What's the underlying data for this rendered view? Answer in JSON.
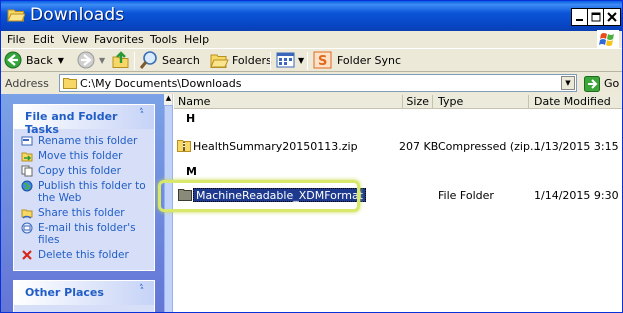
{
  "window": {
    "title": "Downloads",
    "icon": "folder-open-icon"
  },
  "menu": {
    "items": [
      "File",
      "Edit",
      "View",
      "Favorites",
      "Tools",
      "Help"
    ]
  },
  "toolbar": {
    "back_label": "Back",
    "search_label": "Search",
    "folders_label": "Folders",
    "folder_sync_label": "Folder Sync"
  },
  "address": {
    "label": "Address",
    "path": "C:\\My Documents\\Downloads",
    "go_label": "Go"
  },
  "tasks_pane": {
    "title": "File and Folder Tasks",
    "collapse_glyph": "«",
    "items": [
      {
        "label": "Rename this folder",
        "icon": "rename-icon"
      },
      {
        "label": "Move this folder",
        "icon": "move-icon"
      },
      {
        "label": "Copy this folder",
        "icon": "copy-icon"
      },
      {
        "label": "Publish this folder to the Web",
        "icon": "publish-web-icon"
      },
      {
        "label": "Share this folder",
        "icon": "share-icon"
      },
      {
        "label": "E-mail this folder's files",
        "icon": "email-icon"
      },
      {
        "label": "Delete this folder",
        "icon": "delete-icon"
      }
    ]
  },
  "other_places": {
    "title": "Other Places",
    "collapse_glyph": "«"
  },
  "list": {
    "columns": [
      "Name",
      "Size",
      "Type",
      "Date Modified"
    ],
    "groups": [
      {
        "header": "H",
        "rows": [
          {
            "name": "HealthSummary20150113.zip",
            "size": "207 KB",
            "type": "Compressed (zip...",
            "modified": "1/13/2015 3:15 ...",
            "icon": "zip-folder-icon"
          }
        ]
      },
      {
        "header": "M",
        "rows": [
          {
            "name": "MachineReadable_XDMFormat",
            "size": "",
            "type": "File Folder",
            "modified": "1/14/2015 9:30 ...",
            "icon": "folder-icon",
            "selected": true
          }
        ]
      }
    ]
  },
  "colors": {
    "title_blue": "#0b55d9",
    "task_link": "#215dc6",
    "selection": "#1d3a8f",
    "highlight_ring": "#d7e86a"
  }
}
